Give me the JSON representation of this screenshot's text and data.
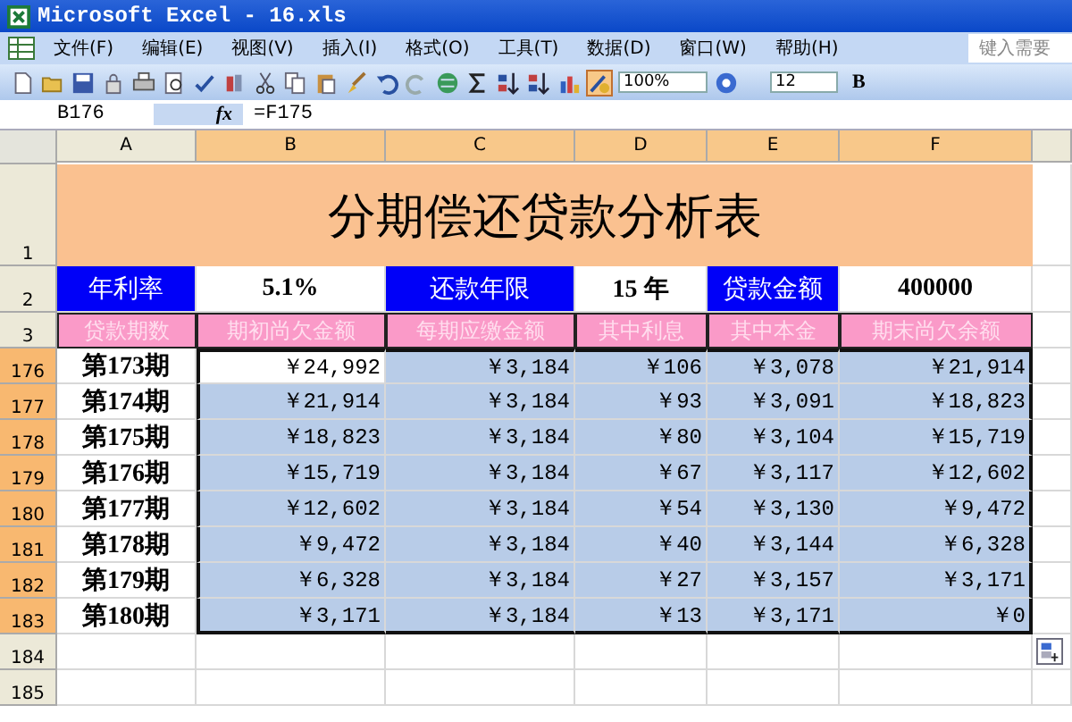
{
  "window": {
    "title": "Microsoft Excel - 16.xls"
  },
  "menu": [
    "文件(F)",
    "编辑(E)",
    "视图(V)",
    "插入(I)",
    "格式(O)",
    "工具(T)",
    "数据(D)",
    "窗口(W)",
    "帮助(H)"
  ],
  "help_box": {
    "placeholder": "键入需要"
  },
  "toolbar": {
    "zoom": "100%",
    "font_size": "12",
    "bold_label": "B"
  },
  "formula_bar": {
    "name_box": "B176",
    "fx": "fx",
    "formula": "=F175"
  },
  "columns": [
    {
      "label": "A",
      "selected": false
    },
    {
      "label": "B",
      "selected": true
    },
    {
      "label": "C",
      "selected": true
    },
    {
      "label": "D",
      "selected": true
    },
    {
      "label": "E",
      "selected": true
    },
    {
      "label": "F",
      "selected": true
    }
  ],
  "title_row": {
    "row": "1",
    "text": "分期偿还贷款分析表"
  },
  "params_row": {
    "row": "2",
    "cells": [
      {
        "kind": "label",
        "text": "年利率"
      },
      {
        "kind": "value",
        "text": "5.1%"
      },
      {
        "kind": "label",
        "text": "还款年限"
      },
      {
        "kind": "value",
        "text": "15 年"
      },
      {
        "kind": "label",
        "text": "贷款金额"
      },
      {
        "kind": "value",
        "text": "400000"
      }
    ]
  },
  "header_row": {
    "row": "3",
    "cells": [
      "贷款期数",
      "期初尚欠金额",
      "每期应缴金额",
      "其中利息",
      "其中本金",
      "期末尚欠余额"
    ]
  },
  "rows": [
    {
      "row": "176",
      "selected": true,
      "cells": [
        {
          "text": "第173期",
          "highlighted": false
        },
        {
          "text": "￥24,992",
          "highlighted": false
        },
        {
          "text": "￥3,184",
          "highlighted": true
        },
        {
          "text": "￥106",
          "highlighted": true
        },
        {
          "text": "￥3,078",
          "highlighted": true
        },
        {
          "text": "￥21,914",
          "highlighted": true
        }
      ]
    },
    {
      "row": "177",
      "selected": true,
      "cells": [
        {
          "text": "第174期",
          "highlighted": false
        },
        {
          "text": "￥21,914",
          "highlighted": true
        },
        {
          "text": "￥3,184",
          "highlighted": true
        },
        {
          "text": "￥93",
          "highlighted": true
        },
        {
          "text": "￥3,091",
          "highlighted": true
        },
        {
          "text": "￥18,823",
          "highlighted": true
        }
      ]
    },
    {
      "row": "178",
      "selected": true,
      "cells": [
        {
          "text": "第175期",
          "highlighted": false
        },
        {
          "text": "￥18,823",
          "highlighted": true
        },
        {
          "text": "￥3,184",
          "highlighted": true
        },
        {
          "text": "￥80",
          "highlighted": true
        },
        {
          "text": "￥3,104",
          "highlighted": true
        },
        {
          "text": "￥15,719",
          "highlighted": true
        }
      ]
    },
    {
      "row": "179",
      "selected": true,
      "cells": [
        {
          "text": "第176期",
          "highlighted": false
        },
        {
          "text": "￥15,719",
          "highlighted": true
        },
        {
          "text": "￥3,184",
          "highlighted": true
        },
        {
          "text": "￥67",
          "highlighted": true
        },
        {
          "text": "￥3,117",
          "highlighted": true
        },
        {
          "text": "￥12,602",
          "highlighted": true
        }
      ]
    },
    {
      "row": "180",
      "selected": true,
      "cells": [
        {
          "text": "第177期",
          "highlighted": false
        },
        {
          "text": "￥12,602",
          "highlighted": true
        },
        {
          "text": "￥3,184",
          "highlighted": true
        },
        {
          "text": "￥54",
          "highlighted": true
        },
        {
          "text": "￥3,130",
          "highlighted": true
        },
        {
          "text": "￥9,472",
          "highlighted": true
        }
      ]
    },
    {
      "row": "181",
      "selected": true,
      "cells": [
        {
          "text": "第178期",
          "highlighted": false
        },
        {
          "text": "￥9,472",
          "highlighted": true
        },
        {
          "text": "￥3,184",
          "highlighted": true
        },
        {
          "text": "￥40",
          "highlighted": true
        },
        {
          "text": "￥3,144",
          "highlighted": true
        },
        {
          "text": "￥6,328",
          "highlighted": true
        }
      ]
    },
    {
      "row": "182",
      "selected": true,
      "cells": [
        {
          "text": "第179期",
          "highlighted": false
        },
        {
          "text": "￥6,328",
          "highlighted": true
        },
        {
          "text": "￥3,184",
          "highlighted": true
        },
        {
          "text": "￥27",
          "highlighted": true
        },
        {
          "text": "￥3,157",
          "highlighted": true
        },
        {
          "text": "￥3,171",
          "highlighted": true
        }
      ]
    },
    {
      "row": "183",
      "selected": true,
      "cells": [
        {
          "text": "第180期",
          "highlighted": false
        },
        {
          "text": "￥3,171",
          "highlighted": true
        },
        {
          "text": "￥3,184",
          "highlighted": true
        },
        {
          "text": "￥13",
          "highlighted": true
        },
        {
          "text": "￥3,171",
          "highlighted": true
        },
        {
          "text": "￥0",
          "highlighted": true
        }
      ]
    }
  ],
  "empty_rows": [
    {
      "row": "184",
      "selected": false
    },
    {
      "row": "185",
      "selected": false
    }
  ]
}
